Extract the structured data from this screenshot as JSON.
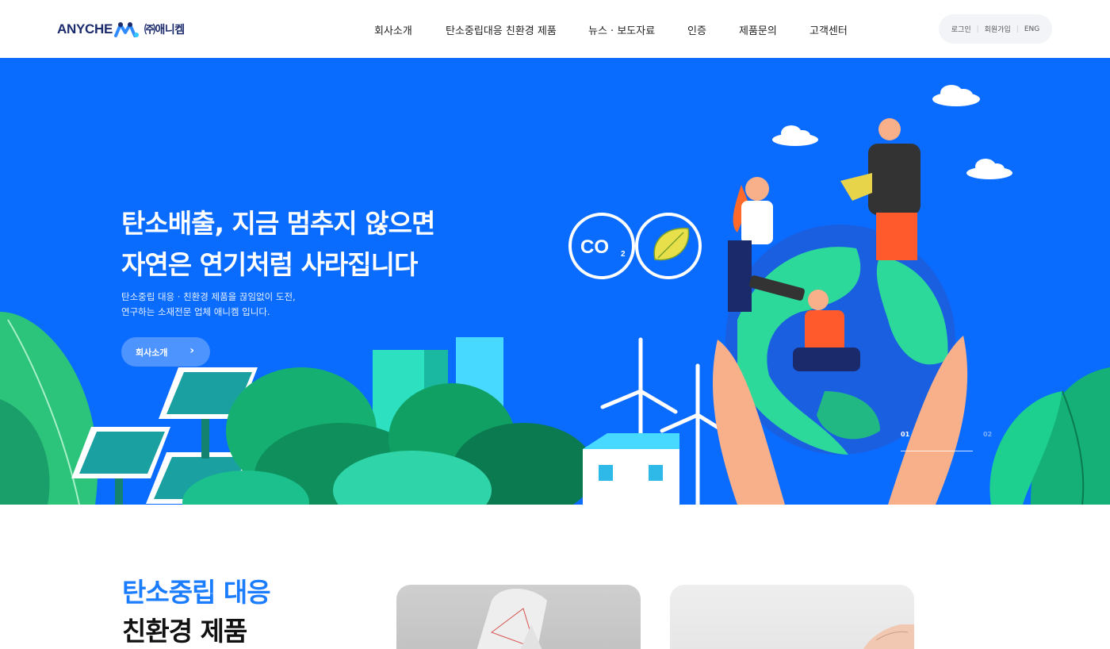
{
  "brand": {
    "logo_text": "ANYCHE",
    "logo_ko": "㈜애니켐",
    "colors": {
      "primary": "#0a6bff",
      "navy": "#1b2a6b",
      "accent_blue": "#1a7cff"
    }
  },
  "nav": {
    "items": [
      {
        "label": "회사소개"
      },
      {
        "label": "탄소중립대응 친환경 제품"
      },
      {
        "label": "뉴스 · 보도자료"
      },
      {
        "label": "인증"
      },
      {
        "label": "제품문의"
      },
      {
        "label": "고객센터"
      }
    ]
  },
  "util": {
    "login": "로그인",
    "signup": "회원가입",
    "lang": "ENG"
  },
  "hero": {
    "title_line1": "탄소배출, 지금 멈추지 않으면",
    "title_line2": "자연은 연기처럼 사라집니다",
    "sub_line1": "탄소중립 대응 · 친환경 제품을 끊임없이 도전,",
    "sub_line2": "연구하는 소재전문 업체 애니켐 입니다.",
    "button_label": "회사소개",
    "button_icon": "chevron-right-icon",
    "co2_label": "CO",
    "co2_sub": "2",
    "slide_current": "01",
    "slide_next": "02"
  },
  "section": {
    "title_line1": "탄소중립 대응",
    "title_line2": "친환경 제품"
  }
}
